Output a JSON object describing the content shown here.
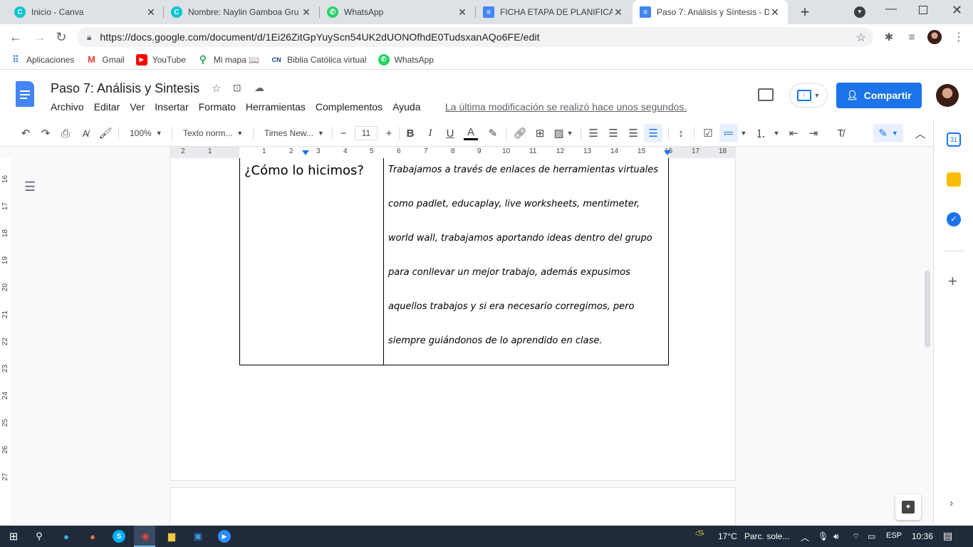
{
  "browser": {
    "tabs": [
      {
        "title": "Inicio - Canva",
        "icon": "canva-icon",
        "color": "#7d2ae8",
        "letter": "C"
      },
      {
        "title": "Nombre: Naylin Gamboa Gru",
        "icon": "canva-icon",
        "color": "#7d2ae8",
        "letter": "C"
      },
      {
        "title": "WhatsApp",
        "icon": "whatsapp-icon",
        "color": "#25d366",
        "letter": "✆"
      },
      {
        "title": "FICHA ETAPA DE PLANIFICAC",
        "icon": "docs-icon",
        "color": "#4285f4",
        "letter": "≡"
      },
      {
        "title": "Paso 7: Análisis y Síntesis - Do",
        "icon": "docs-icon",
        "color": "#4285f4",
        "letter": "≡",
        "active": true
      }
    ],
    "url": "https://docs.google.com/document/d/1Ei26ZitGpYuyScn54UK2dUONOfhdE0TudsxanAQo6FE/edit",
    "bookmarks": [
      {
        "label": "Aplicaciones",
        "icon": "apps-grid-icon"
      },
      {
        "label": "Gmail",
        "icon": "gmail-icon"
      },
      {
        "label": "YouTube",
        "icon": "youtube-icon"
      },
      {
        "label": "Mi mapa 📖",
        "icon": "maps-pin-icon"
      },
      {
        "label": "Biblia Católica virtual",
        "icon": "bible-icon"
      },
      {
        "label": "WhatsApp",
        "icon": "whatsapp-icon"
      }
    ]
  },
  "docs": {
    "title": "Paso 7: Análisis y Sintesis",
    "menu": [
      "Archivo",
      "Editar",
      "Ver",
      "Insertar",
      "Formato",
      "Herramientas",
      "Complementos",
      "Ayuda"
    ],
    "last_modified": "La última modificación se realizó hace unos segundos.",
    "share_label": "Compartir",
    "toolbar": {
      "zoom": "100%",
      "style": "Texto norm...",
      "font": "Times New...",
      "font_size": "11"
    },
    "ruler_h": [
      "2",
      "1",
      "1",
      "2",
      "3",
      "4",
      "5",
      "6",
      "7",
      "8",
      "9",
      "10",
      "11",
      "12",
      "13",
      "14",
      "15",
      "16",
      "17",
      "18"
    ],
    "ruler_v": [
      "16",
      "17",
      "18",
      "19",
      "20",
      "21",
      "22",
      "23",
      "24",
      "25",
      "26",
      "27"
    ],
    "table": {
      "question": "¿Cómo lo hicimos?",
      "answer_lines": [
        "Trabajamos a través de  enlaces de herramientas virtuales",
        "como  padlet, educaplay, live worksheets, mentimeter,",
        "world wall, trabajamos aportando ideas dentro del grupo",
        "para conllevar un mejor trabajo, además expusimos",
        "aquellos trabajos y si era necesario corregimos, pero",
        "siempre guiándonos de lo aprendido en clase."
      ]
    }
  },
  "taskbar": {
    "temperature": "17°C",
    "weather": "Parc. sole...",
    "language": "ESP",
    "time": "10:36"
  },
  "colors": {
    "accent": "#1a73e8",
    "taskbar": "#1f2a3a"
  }
}
